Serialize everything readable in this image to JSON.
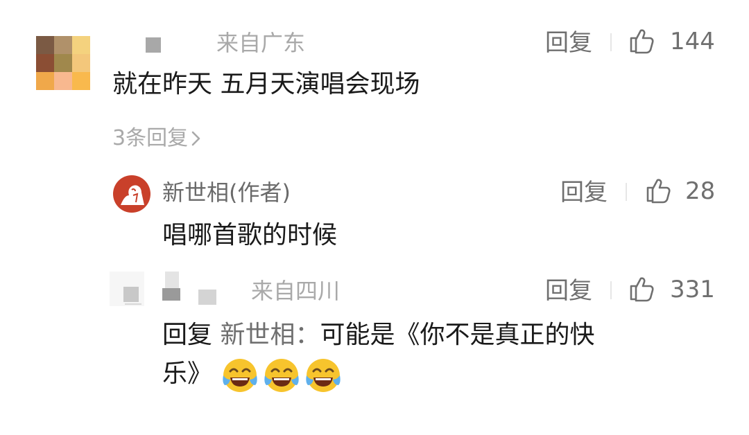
{
  "comments": [
    {
      "location": "来自广东",
      "reply_label": "回复",
      "likes": "144",
      "text": "就在昨天  五月天演唱会现场",
      "more_replies": "3条回复"
    }
  ],
  "replies": [
    {
      "author": "新世相(作者)",
      "reply_label": "回复",
      "likes": "28",
      "text": "唱哪首歌的时候"
    },
    {
      "location": "来自四川",
      "reply_label": "回复",
      "likes": "331",
      "prefix": "回复",
      "reply_to": "新世相：",
      "text_line1": "可能是《你不是真正的快",
      "text_line2": "乐》"
    }
  ],
  "icons": {
    "like": "thumbs-up-icon",
    "chevron": "chevron-right-icon",
    "emoji": "tears-of-joy-emoji"
  },
  "colors": {
    "text_primary": "#1a1a1a",
    "text_secondary": "#6f6f6f",
    "text_muted": "#a9a9a9",
    "emoji_yellow": "#f7c42d",
    "avatar_red": "#c9402a"
  }
}
